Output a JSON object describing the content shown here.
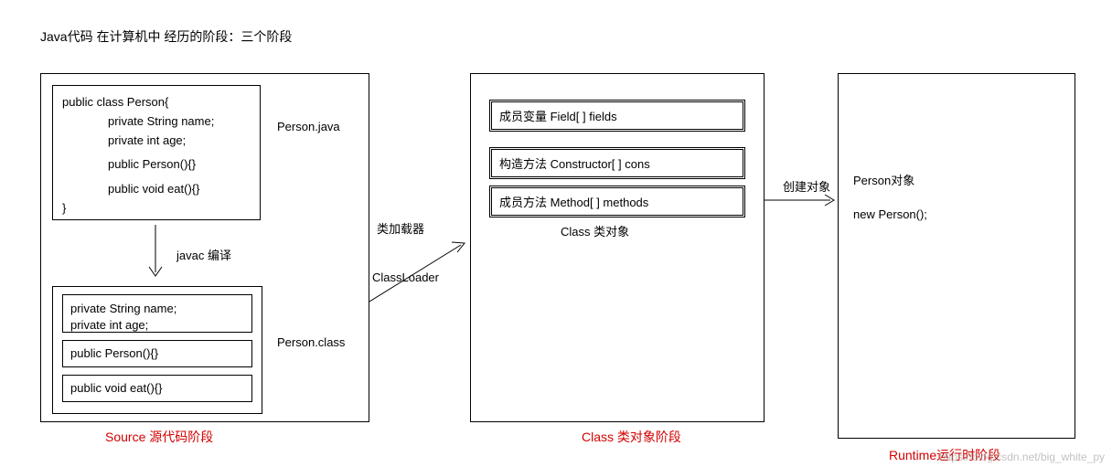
{
  "title": "Java代码 在计算机中 经历的阶段：三个阶段",
  "stage1": {
    "caption": "Source 源代码阶段",
    "java_file_label": "Person.java",
    "javac_label": "javac 编译",
    "class_file_label": "Person.class",
    "code": {
      "line1": "public class Person{",
      "line2": "private String name;",
      "line3": "private int age;",
      "line4": "public Person(){}",
      "line5": "public void eat(){}",
      "line6": "}"
    },
    "compiled": {
      "fields": "private String name;\nprivate int age;",
      "constructor": "public Person(){}",
      "method": "public void eat(){}"
    }
  },
  "connector1": {
    "label_cn": "类加载器",
    "label_en": "ClassLoader"
  },
  "stage2": {
    "caption": "Class 类对象阶段",
    "fields": "成员变量  Field[ ] fields",
    "constructors": "构造方法  Constructor[ ] cons",
    "methods": "成员方法 Method[ ] methods",
    "class_obj": "Class 类对象"
  },
  "connector2": {
    "label": "创建对象"
  },
  "stage3": {
    "caption": "Runtime运行时阶段",
    "obj_label": "Person对象",
    "new_stmt": "new Person();"
  },
  "watermark": "https://blog.csdn.net/big_white_py"
}
